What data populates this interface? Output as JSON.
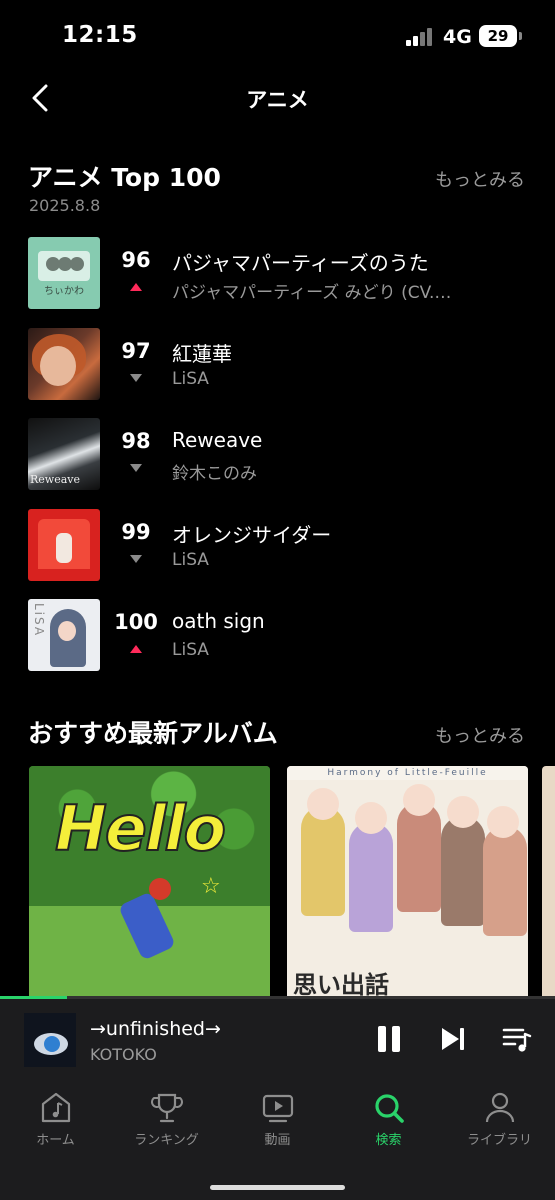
{
  "status": {
    "time": "12:15",
    "network": "4G",
    "battery": "29"
  },
  "header": {
    "title": "アニメ"
  },
  "ranking": {
    "title": "アニメ Top 100",
    "more": "もっとみる",
    "date": "2025.8.8",
    "items": [
      {
        "rank": "96",
        "trend": "up",
        "title": "パジャマパーティーズのうた",
        "artist": "パジャマパーティーズ みどり (CV.…",
        "cover_text": "ちぃかわ"
      },
      {
        "rank": "97",
        "trend": "down",
        "title": "紅蓮華",
        "artist": "LiSA",
        "cover_text": ""
      },
      {
        "rank": "98",
        "trend": "down",
        "title": "Reweave",
        "artist": "鈴木このみ",
        "cover_text": "Reweave"
      },
      {
        "rank": "99",
        "trend": "down",
        "title": "オレンジサイダー",
        "artist": "LiSA",
        "cover_text": ""
      },
      {
        "rank": "100",
        "trend": "up",
        "title": "oath sign",
        "artist": "LiSA",
        "cover_text": "LiSA"
      }
    ]
  },
  "recommended": {
    "title": "おすすめ最新アルバム",
    "more": "もっとみる",
    "albums": [
      {
        "cover_text": "Hello"
      },
      {
        "cover_text": "思い出話",
        "band_text": "Harmony of Little-Feuille"
      }
    ]
  },
  "now_playing": {
    "title": "→unfinished→",
    "artist": "KOTOKO",
    "progress": 0.12
  },
  "tabs": [
    {
      "label": "ホーム",
      "icon": "music-note-icon",
      "active": false
    },
    {
      "label": "ランキング",
      "icon": "trophy-icon",
      "active": false
    },
    {
      "label": "動画",
      "icon": "video-icon",
      "active": false
    },
    {
      "label": "検索",
      "icon": "search-icon",
      "active": true
    },
    {
      "label": "ライブラリ",
      "icon": "person-icon",
      "active": false
    }
  ],
  "colors": {
    "accent": "#2ad36a",
    "trend_up": "#ff2a5a",
    "trend_down": "#8a8a8a",
    "background": "#000000"
  }
}
